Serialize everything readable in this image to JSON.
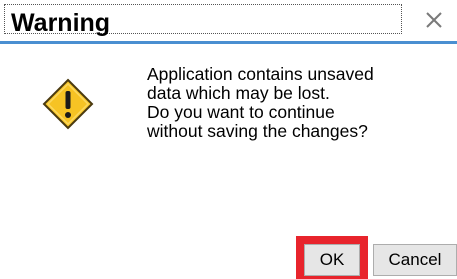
{
  "dialog": {
    "title": "Warning",
    "close_icon": "close-icon",
    "status_icon": "warning-icon",
    "message_lines": [
      "Application contains unsaved",
      "data which may be lost.",
      "Do you want to continue",
      "without saving the changes?"
    ],
    "buttons": {
      "ok_label": "OK",
      "cancel_label": "Cancel"
    },
    "colors": {
      "accent_line": "#4a8fd1",
      "highlight": "#e8242c",
      "warning_fill": "#f6c324"
    }
  }
}
